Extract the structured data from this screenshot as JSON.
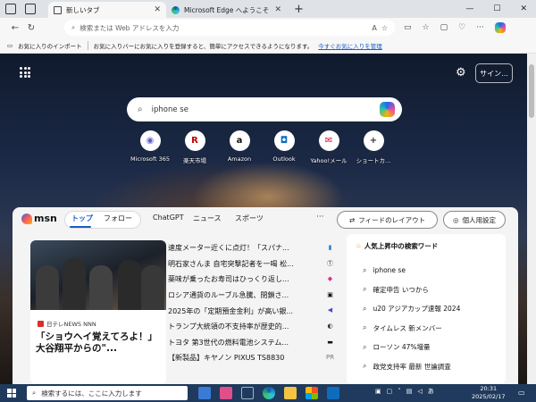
{
  "tabs": [
    {
      "label": "新しいタブ",
      "active": true
    },
    {
      "label": "Microsoft Edge へようこそ",
      "active": false
    }
  ],
  "address": {
    "placeholder": "検索または Web アドレスを入力",
    "read_aloud": "A"
  },
  "favorites_bar": {
    "import_label": "お気に入りのインポート",
    "message": "お気に入りバーにお気に入りを登録すると、簡単にアクセスできるようになります。",
    "link": "今すぐお気に入りを管理"
  },
  "header": {
    "signin_label": "サイン..."
  },
  "search": {
    "value": "iphone se"
  },
  "shortcuts": [
    {
      "label": "Microsoft 365",
      "glyph": "◉",
      "color": "#5b5fc7"
    },
    {
      "label": "楽天市場",
      "glyph": "R",
      "color": "#bf0000"
    },
    {
      "label": "Amazon",
      "glyph": "a",
      "color": "#111111"
    },
    {
      "label": "Outlook",
      "glyph": "◘",
      "color": "#0f6cbd"
    },
    {
      "label": "Yahoo!メール",
      "glyph": "✉",
      "color": "#e0003c"
    },
    {
      "label": "ショートカ...",
      "glyph": "+",
      "color": "#333333"
    }
  ],
  "msn": {
    "logo": "msn",
    "nav": [
      "トップ",
      "フォロー",
      "ChatGPT",
      "ニュース",
      "スポーツ"
    ],
    "more": "···",
    "feed_layout_label": "フィードのレイアウト",
    "personalize_label": "個人用設定"
  },
  "news": {
    "source": "日テレNEWS NNN",
    "title": "「ショウヘイ覚えてろよ！」大谷翔平からの\"..."
  },
  "headlines": [
    {
      "text": "速度メーター近くに点灯！「スパナ...",
      "icon": "▮",
      "icon_color": "#2c7fd6"
    },
    {
      "text": "明石家さんま 自宅突撃記者を一喝 松...",
      "icon": "Ⓣ",
      "icon_color": "#333333"
    },
    {
      "text": "薬味が乗ったお寿司はひっくり返し...",
      "icon": "◆",
      "icon_color": "#d9308c"
    },
    {
      "text": "ロシア通貨のルーブル急騰、閉鎖さ...",
      "icon": "▣",
      "icon_color": "#111111"
    },
    {
      "text": "2025年の「定期預金金利」が高い銀...",
      "icon": "◀",
      "icon_color": "#4b4bd6"
    },
    {
      "text": "トランプ大統領の不支持率が歴史的...",
      "icon": "◐",
      "icon_color": "#333333"
    },
    {
      "text": "トヨタ 第3世代の燃料電池システム...",
      "icon": "▬",
      "icon_color": "#111111"
    },
    {
      "text": "【新製品】キヤノン PIXUS TS8830",
      "icon": "PR",
      "icon_color": "#777777"
    }
  ],
  "trending": {
    "title": "人気上昇中の検索ワード",
    "items": [
      "iphone se",
      "確定申告 いつから",
      "u20 アジアカップ速報 2024",
      "タイムレス 新メンバー",
      "ローソン 47%増量",
      "政党支持率 最新 世論調査"
    ]
  },
  "taskbar": {
    "search_placeholder": "検索するには、ここに入力します",
    "ime": "あ",
    "time": "20:31",
    "date": "2025/02/17"
  }
}
